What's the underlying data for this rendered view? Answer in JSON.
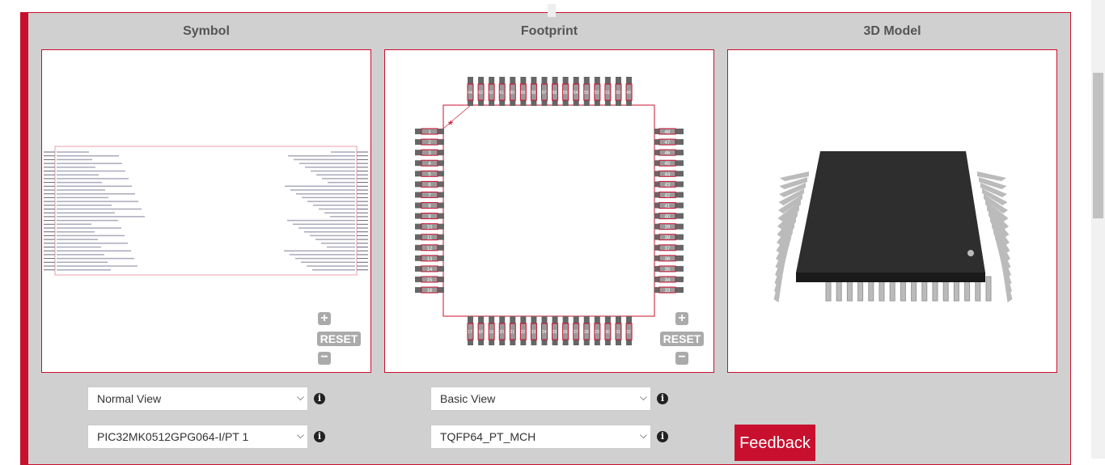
{
  "headings": {
    "symbol": "Symbol",
    "footprint": "Footprint",
    "model": "3D Model"
  },
  "controls": {
    "zoom_in": "+",
    "reset": "RESET",
    "zoom_out": "−"
  },
  "symbol_view": {
    "selected": "Normal View"
  },
  "symbol_part": {
    "selected": "PIC32MK0512GPG064-I/PT 1"
  },
  "footprint_view": {
    "selected": "Basic View"
  },
  "footprint_name": {
    "selected": "TQFP64_PT_MCH"
  },
  "feedback": "Feedback",
  "footprint": {
    "pins": 64,
    "pins_per_side": 16
  },
  "colors": {
    "accent": "#c8102e",
    "pad": "#666666"
  }
}
